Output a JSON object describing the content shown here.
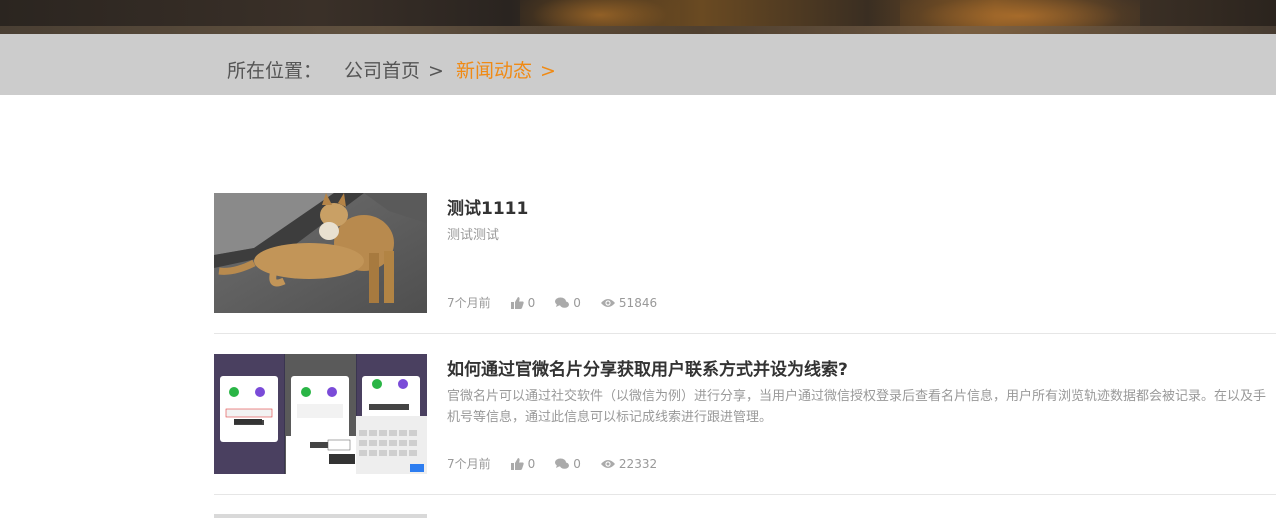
{
  "breadcrumb": {
    "label": "所在位置：",
    "home": "公司首页",
    "separator1": ">",
    "current": "新闻动态",
    "separator2": ">"
  },
  "colors": {
    "accent": "#f08a14",
    "breadcrumb_bg": "#cccccc",
    "title": "#333333",
    "muted": "#999999"
  },
  "articles": [
    {
      "title": "测试1111",
      "desc": "测试测试",
      "time": "7个月前",
      "likes": "0",
      "comments": "0",
      "views": "51846",
      "thumb_icon": "dog-photo"
    },
    {
      "title": "如何通过官微名片分享获取用户联系方式并设为线索?",
      "desc": "官微名片可以通过社交软件（以微信为例）进行分享，当用户通过微信授权登录后查看名片信息，用户所有浏览轨迹数据都会被记录。在以及手机号等信息，通过此信息可以标记成线索进行跟进管理。",
      "time": "7个月前",
      "likes": "0",
      "comments": "0",
      "views": "22332",
      "thumb_icon": "app-screenshots"
    }
  ]
}
